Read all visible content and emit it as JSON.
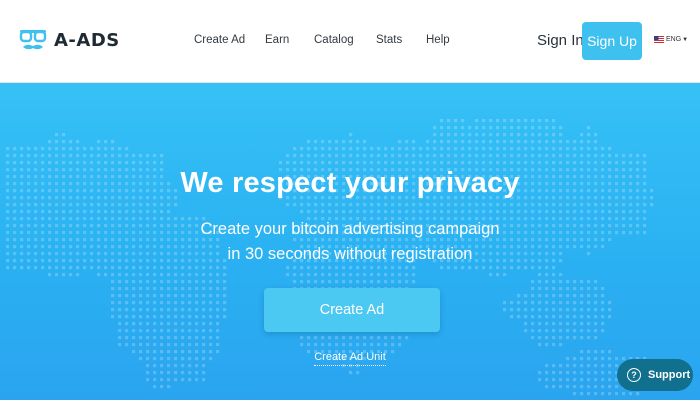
{
  "brand": {
    "name": "A-ADS",
    "logo_icon": "glasses-mustache-icon",
    "accent": "#3ec1ee"
  },
  "nav": {
    "items": [
      {
        "label": "Create Ad"
      },
      {
        "label": "Earn"
      },
      {
        "label": "Catalog"
      },
      {
        "label": "Stats"
      },
      {
        "label": "Help"
      }
    ]
  },
  "auth": {
    "signin_label": "Sign In",
    "signup_label": "Sign Up"
  },
  "language": {
    "code": "ENG",
    "flag_icon": "us-flag-icon"
  },
  "hero": {
    "title": "We respect your privacy",
    "subtitle_line1": "Create your bitcoin advertising campaign",
    "subtitle_line2": "in 30 seconds without registration",
    "cta_label": "Create Ad",
    "secondary_link": "Create Ad Unit",
    "background_colors": [
      "#36c1f6",
      "#2aa4ef"
    ]
  },
  "support": {
    "label": "Support",
    "icon": "question-circle-icon",
    "color": "#10708e"
  }
}
